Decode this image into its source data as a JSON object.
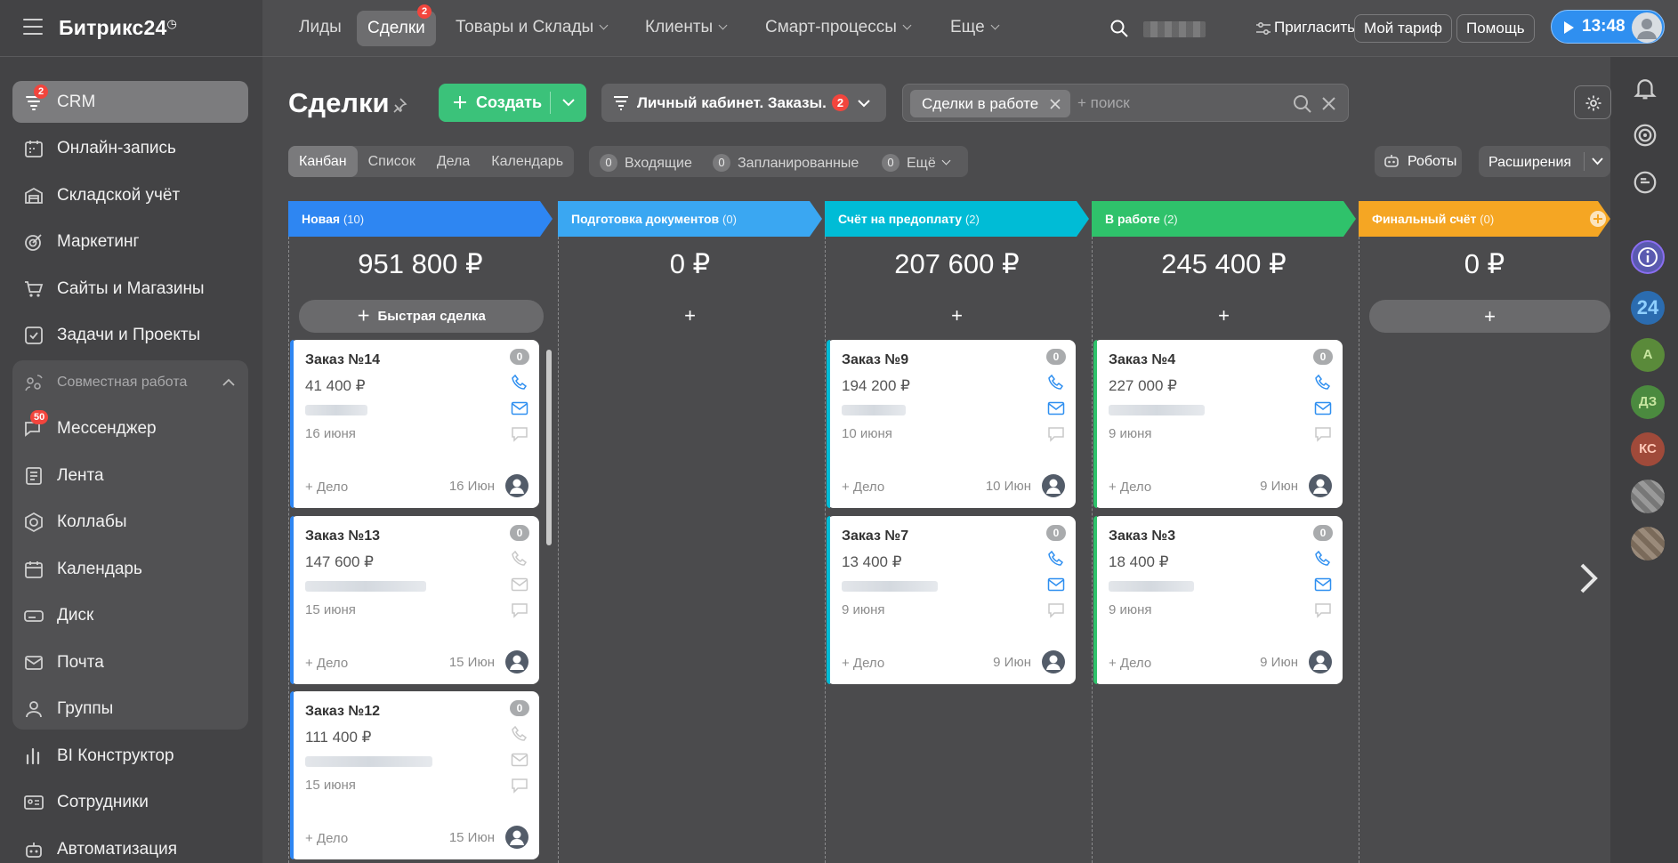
{
  "sidebar": {
    "logo": "Битрикс24",
    "items": [
      {
        "label": "CRM",
        "badge": "2"
      },
      {
        "label": "Онлайн-запись"
      },
      {
        "label": "Складской учёт"
      },
      {
        "label": "Маркетинг"
      },
      {
        "label": "Сайты и Магазины"
      },
      {
        "label": "Задачи и Проекты"
      }
    ],
    "group": {
      "title": "Совместная работа",
      "items": [
        {
          "label": "Мессенджер",
          "badge": "50"
        },
        {
          "label": "Лента"
        },
        {
          "label": "Коллабы"
        },
        {
          "label": "Календарь"
        },
        {
          "label": "Диск"
        },
        {
          "label": "Почта"
        },
        {
          "label": "Группы"
        }
      ]
    },
    "bottom_items": [
      {
        "label": "BI Конструктор"
      },
      {
        "label": "Сотрудники"
      },
      {
        "label": "Автоматизация"
      }
    ]
  },
  "topbar": {
    "nav": [
      {
        "label": "Лиды"
      },
      {
        "label": "Сделки",
        "badge": "2"
      },
      {
        "label": "Товары и Склады"
      },
      {
        "label": "Клиенты"
      },
      {
        "label": "Смарт-процессы"
      },
      {
        "label": "Еще"
      }
    ],
    "invite": "Пригласить",
    "tariff": "Мой тариф",
    "help": "Помощь",
    "time": "13:48"
  },
  "toolbar": {
    "title": "Сделки",
    "create": "Создать",
    "funnel": "Личный кабинет. Заказы.",
    "funnel_badge": "2",
    "filter_chip": "Сделки в работе",
    "search_placeholder": "+ поиск"
  },
  "views": {
    "tabs": [
      "Канбан",
      "Список",
      "Дела",
      "Календарь"
    ],
    "counters": [
      {
        "n": "0",
        "label": "Входящие"
      },
      {
        "n": "0",
        "label": "Запланированные"
      },
      {
        "n": "0",
        "label": "Ещё"
      }
    ],
    "robots": "Роботы",
    "extensions": "Расширения"
  },
  "quick_deal": "Быстрая сделка",
  "columns": [
    {
      "title": "Новая",
      "count": "(10)",
      "sum": "951 800 ₽",
      "color": "#2e86f2",
      "cards": [
        {
          "title": "Заказ №14",
          "sum": "41 400 ₽",
          "date": "16 июня",
          "add": "+ Дело",
          "date_short": "16 Июн",
          "zero": "0"
        },
        {
          "title": "Заказ №13",
          "sum": "147 600 ₽",
          "date": "15 июня",
          "add": "+ Дело",
          "date_short": "15 Июн",
          "zero": "0"
        },
        {
          "title": "Заказ №12",
          "sum": "111 400 ₽",
          "date": "15 июня",
          "add": "+ Дело",
          "date_short": "15 Июн",
          "zero": "0"
        }
      ]
    },
    {
      "title": "Подготовка документов",
      "count": "(0)",
      "sum": "0 ₽",
      "color": "#3aa7f2",
      "cards": []
    },
    {
      "title": "Счёт на предоплату",
      "count": "(2)",
      "sum": "207 600 ₽",
      "color": "#00bcd6",
      "cards": [
        {
          "title": "Заказ №9",
          "sum": "194 200 ₽",
          "date": "10 июня",
          "add": "+ Дело",
          "date_short": "10 Июн",
          "zero": "0"
        },
        {
          "title": "Заказ №7",
          "sum": "13 400 ₽",
          "date": "9 июня",
          "add": "+ Дело",
          "date_short": "9 Июн",
          "zero": "0"
        }
      ]
    },
    {
      "title": "В работе",
      "count": "(2)",
      "sum": "245 400 ₽",
      "color": "#2fc26b",
      "cards": [
        {
          "title": "Заказ №4",
          "sum": "227 000 ₽",
          "date": "9 июня",
          "add": "+ Дело",
          "date_short": "9 Июн",
          "zero": "0"
        },
        {
          "title": "Заказ №3",
          "sum": "18 400 ₽",
          "date": "9 июня",
          "add": "+ Дело",
          "date_short": "9 Июн",
          "zero": "0"
        }
      ]
    },
    {
      "title": "Финальный счёт",
      "count": "(0)",
      "sum": "0 ₽",
      "color": "#f5a623",
      "cards": []
    }
  ],
  "rail_avatars": [
    "24",
    "А",
    "ДЗ",
    "КС"
  ]
}
